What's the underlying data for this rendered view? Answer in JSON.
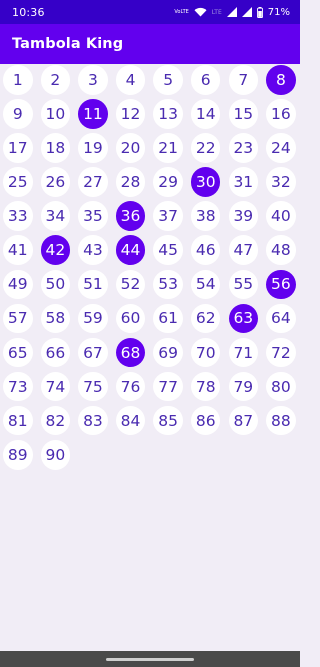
{
  "status_bar": {
    "time": "10:36",
    "network_label": "VoLTE",
    "lte_label": "LTE",
    "battery": "71%",
    "icons": [
      "wifi-icon",
      "signal-icon",
      "battery-icon"
    ]
  },
  "app_bar": {
    "title": "Tambola King"
  },
  "board": {
    "numbers": [
      "1",
      "2",
      "3",
      "4",
      "5",
      "6",
      "7",
      "8",
      "9",
      "10",
      "11",
      "12",
      "13",
      "14",
      "15",
      "16",
      "17",
      "18",
      "19",
      "20",
      "21",
      "22",
      "23",
      "24",
      "25",
      "26",
      "27",
      "28",
      "29",
      "30",
      "31",
      "32",
      "33",
      "34",
      "35",
      "36",
      "37",
      "38",
      "39",
      "40",
      "41",
      "42",
      "43",
      "44",
      "45",
      "46",
      "47",
      "48",
      "49",
      "50",
      "51",
      "52",
      "53",
      "54",
      "55",
      "56",
      "57",
      "58",
      "59",
      "60",
      "61",
      "62",
      "63",
      "64",
      "65",
      "66",
      "67",
      "68",
      "69",
      "70",
      "71",
      "72",
      "73",
      "74",
      "75",
      "76",
      "77",
      "78",
      "79",
      "80",
      "81",
      "82",
      "83",
      "84",
      "85",
      "86",
      "87",
      "88",
      "89",
      "90"
    ],
    "called": [
      "8",
      "11",
      "30",
      "36",
      "42",
      "44",
      "56",
      "63",
      "68"
    ]
  },
  "colors": {
    "status_bar": "#3600C8",
    "app_bar": "#6200EE",
    "called_fill": "#6200EE",
    "number_text": "#4A2BB0",
    "background": "#F1EDF6"
  }
}
